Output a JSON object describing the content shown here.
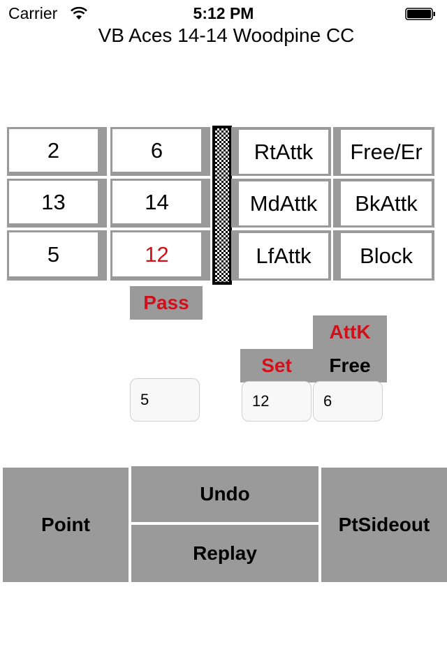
{
  "status_bar": {
    "carrier": "Carrier",
    "wifi_icon": "wifi-icon",
    "time": "5:12 PM",
    "battery_icon": "battery-full-icon"
  },
  "header": {
    "title": "VB Aces  14-14  Woodpine CC"
  },
  "rotation": {
    "cells": [
      {
        "label": "2",
        "highlight": false
      },
      {
        "label": "6",
        "highlight": false
      },
      {
        "label": "13",
        "highlight": false
      },
      {
        "label": "14",
        "highlight": false
      },
      {
        "label": "5",
        "highlight": false
      },
      {
        "label": "12",
        "highlight": true
      }
    ]
  },
  "actions": {
    "cells": [
      {
        "label": "RtAttk"
      },
      {
        "label": "Free/Er"
      },
      {
        "label": "MdAttk"
      },
      {
        "label": "BkAttk"
      },
      {
        "label": "LfAttk"
      },
      {
        "label": "Block"
      }
    ]
  },
  "labels": {
    "pass": "Pass",
    "attk": "AttK",
    "set": "Set",
    "free": "Free"
  },
  "fields": {
    "pass_value": "5",
    "set_value": "12",
    "free_value": "6"
  },
  "buttons": {
    "point": "Point",
    "undo": "Undo",
    "replay": "Replay",
    "pt_sideout": "PtSideout"
  },
  "colors": {
    "accent_red": "#d0101a",
    "button_gray": "#9a9a9a"
  }
}
